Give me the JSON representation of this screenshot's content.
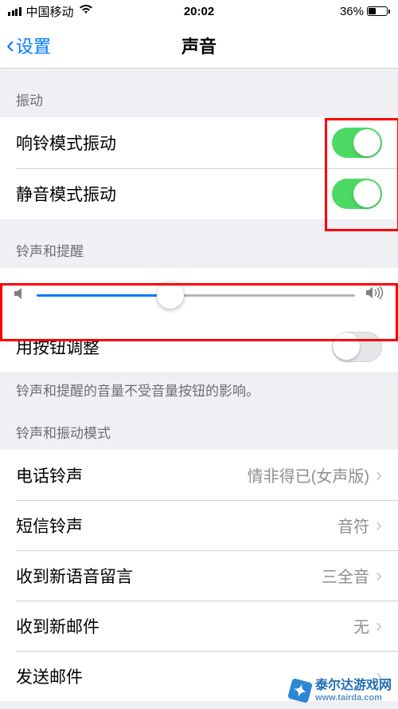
{
  "status": {
    "carrier": "中国移动",
    "time": "20:02",
    "battery_pct": "36%"
  },
  "nav": {
    "back_label": "设置",
    "title": "声音"
  },
  "sections": {
    "vibrate": {
      "header": "振动",
      "ring_vibrate_label": "响铃模式振动",
      "ring_vibrate_on": true,
      "silent_vibrate_label": "静音模式振动",
      "silent_vibrate_on": true
    },
    "volume": {
      "header": "铃声和提醒",
      "slider_value": 0.42,
      "adjust_with_buttons_label": "用按钮调整",
      "adjust_with_buttons_on": false,
      "footer": "铃声和提醒的音量不受音量按钮的影响。"
    },
    "patterns": {
      "header": "铃声和振动模式",
      "items": [
        {
          "label": "电话铃声",
          "value": "情非得已(女声版)"
        },
        {
          "label": "短信铃声",
          "value": "音符"
        },
        {
          "label": "收到新语音留言",
          "value": "三全音"
        },
        {
          "label": "收到新邮件",
          "value": "无"
        },
        {
          "label": "发送邮件",
          "value": ""
        }
      ]
    }
  },
  "watermark": {
    "text": "泰尔达游戏网",
    "url": "www.tairda.com"
  }
}
